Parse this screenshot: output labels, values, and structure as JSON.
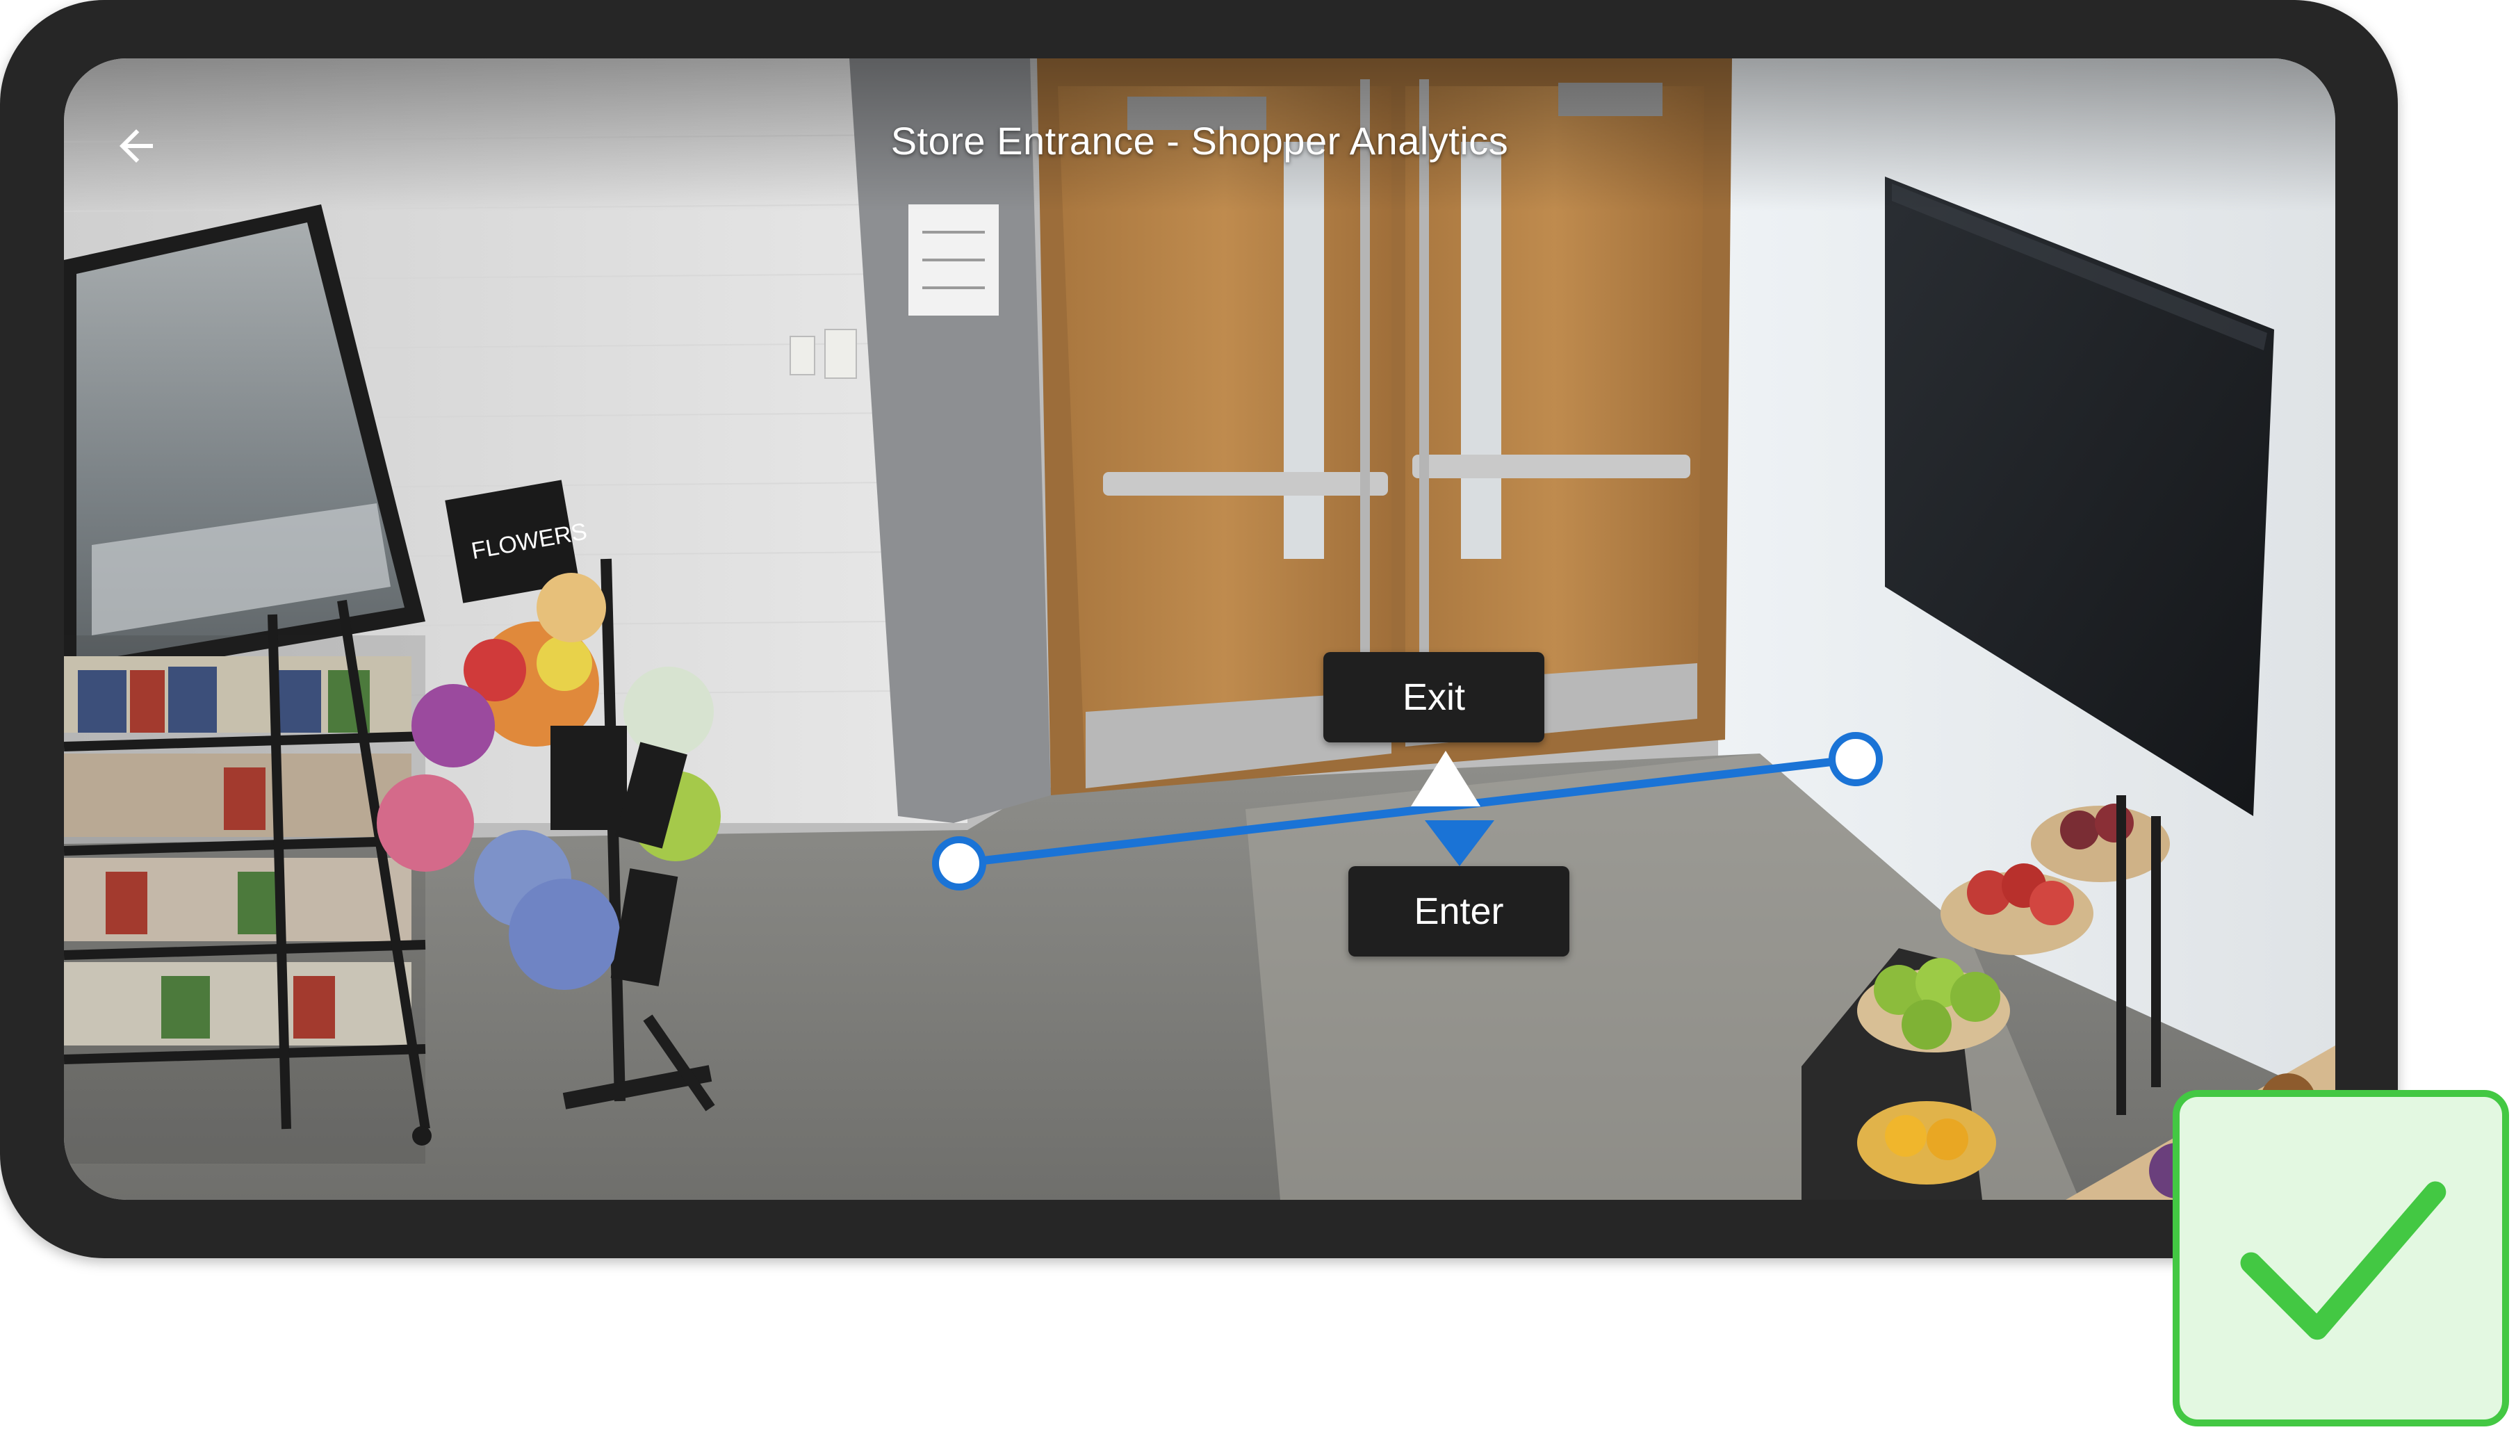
{
  "header": {
    "title": "Store Entrance - Shopper Analytics",
    "back_icon": "arrow-left-icon"
  },
  "scene": {
    "sign_text": "FLOWERS"
  },
  "line_counter": {
    "exit_label": "Exit",
    "enter_label": "Enter",
    "line_color": "#1a73d6",
    "handle_color": "#ffffff"
  },
  "status_badge": {
    "icon": "check-icon",
    "color": "#43c843",
    "background": "#e3f8e1"
  }
}
